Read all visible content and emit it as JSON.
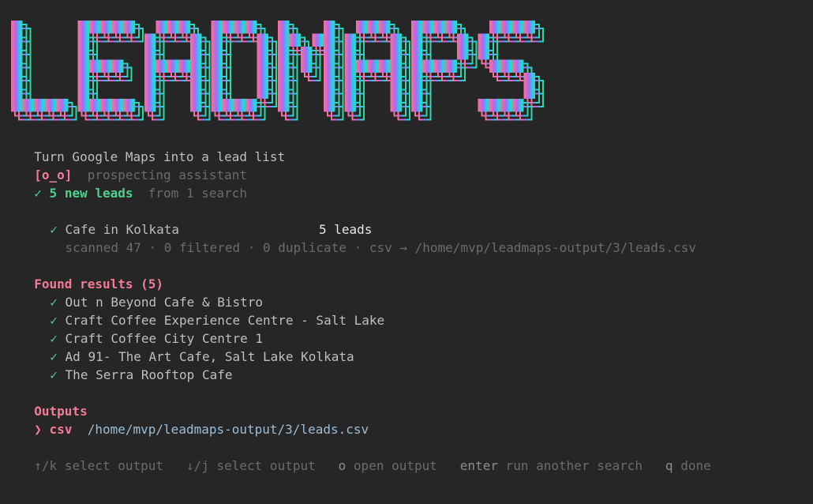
{
  "banner": {
    "title": "LEADMAPS",
    "gradient": [
      "#ff6f91",
      "#c06be0",
      "#8e6cf0",
      "#4aa8f5",
      "#27d4e8",
      "#2ed8a0"
    ]
  },
  "tagline": "Turn Google Maps into a lead list",
  "assistant": {
    "face": "[o_o]",
    "label": "prospecting assistant"
  },
  "summary": {
    "check": "✓",
    "count_label": "5 new leads",
    "detail": "from 1 search"
  },
  "search": {
    "check": "✓",
    "query": "Cafe in Kolkata",
    "leads": "5 leads",
    "stats": "scanned 47 · 0 filtered · 0 duplicate · csv → /home/mvp/leadmaps-output/3/leads.csv"
  },
  "results": {
    "heading": "Found results (5)",
    "check": "✓",
    "items": [
      "Out n Beyond Cafe & Bistro",
      "Craft Coffee Experience Centre - Salt Lake",
      "Craft Coffee City Centre 1",
      "Ad 91- The Art Cafe, Salt Lake Kolkata",
      "The Serra Rooftop Cafe"
    ]
  },
  "outputs": {
    "heading": "Outputs",
    "pointer": "❯",
    "format": "csv",
    "path": "/home/mvp/leadmaps-output/3/leads.csv"
  },
  "help": {
    "up_key": "↑/k",
    "up_label": "select output",
    "down_key": "↓/j",
    "down_label": "select output",
    "open_key": "o",
    "open_label": "open output",
    "enter_key": "enter",
    "enter_label": "run another search",
    "quit_key": "q",
    "quit_label": "done"
  },
  "colors": {
    "background": "#262626",
    "accent_pink": "#f47a98",
    "success_green": "#4fd08a"
  }
}
